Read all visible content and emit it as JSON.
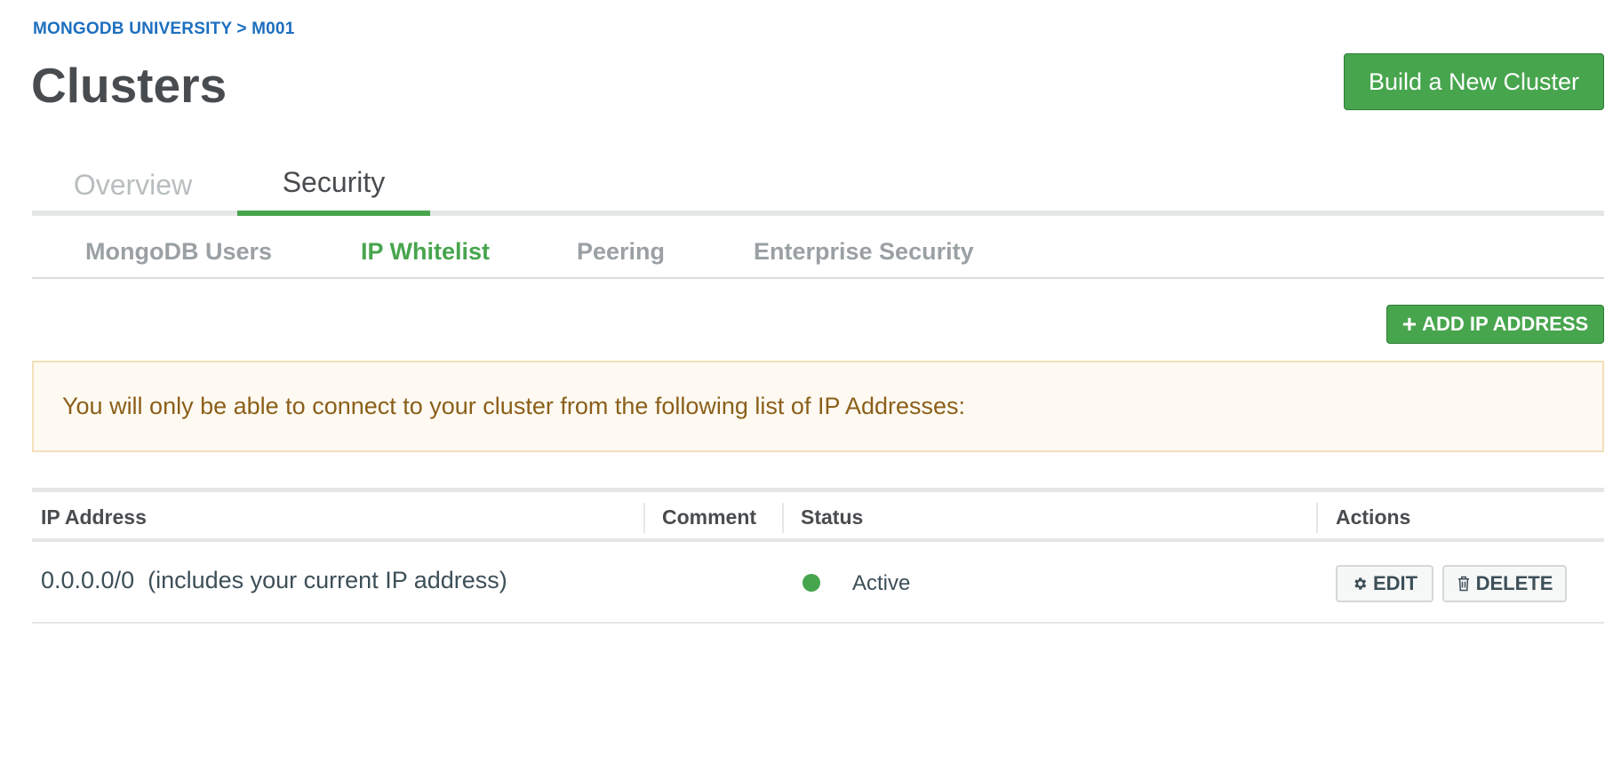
{
  "breadcrumb": "MONGODB UNIVERSITY > M001",
  "page_title": "Clusters",
  "build_button": "Build a New Cluster",
  "main_tabs": [
    {
      "label": "Overview",
      "active": false
    },
    {
      "label": "Security",
      "active": true
    }
  ],
  "sub_tabs": [
    {
      "label": "MongoDB Users",
      "active": false
    },
    {
      "label": "IP Whitelist",
      "active": true
    },
    {
      "label": "Peering",
      "active": false
    },
    {
      "label": "Enterprise Security",
      "active": false
    }
  ],
  "add_ip_button": {
    "icon": "+",
    "label": "ADD IP ADDRESS"
  },
  "notice_text": "You will only be able to connect to your cluster from the following list of IP Addresses:",
  "table": {
    "headers": {
      "ip": "IP Address",
      "comment": "Comment",
      "status": "Status",
      "actions": "Actions"
    },
    "rows": [
      {
        "ip": "0.0.0.0/0  (includes your current IP address)",
        "comment": "",
        "status": "Active",
        "status_color": "#47a54d",
        "edit_label": "EDIT",
        "delete_label": "DELETE"
      }
    ]
  },
  "colors": {
    "accent_green": "#47a54d",
    "link_blue": "#1d6fbf",
    "notice_text": "#8b5f19"
  }
}
